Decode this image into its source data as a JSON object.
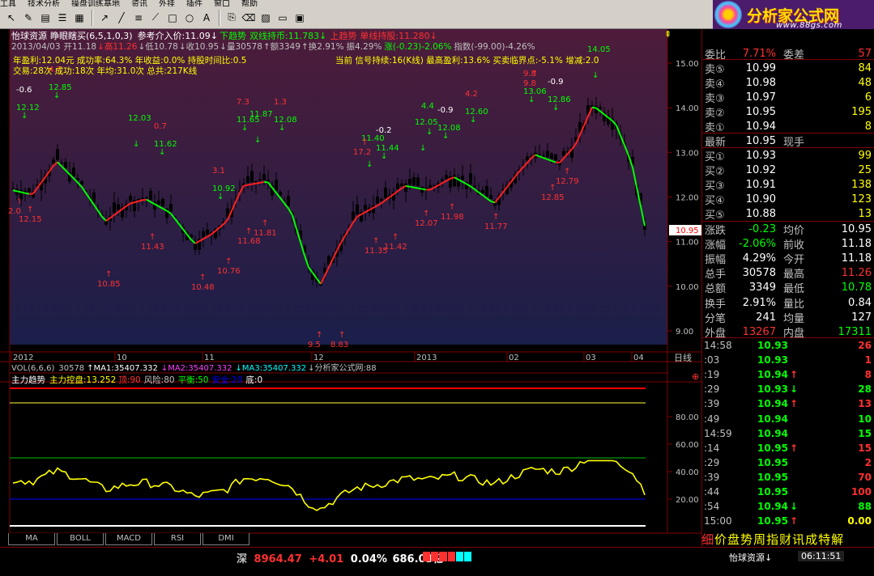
{
  "menu": [
    "工具",
    "技术分析",
    "操盘训练基地",
    "资讯",
    "外挂",
    "插件",
    "窗口",
    "帮助"
  ],
  "logo": {
    "title": "分析家公式网",
    "url": "www.88gs.com"
  },
  "toolbar_icons": [
    "pointer-icon",
    "tool-icon",
    "chart-icon",
    "list-icon",
    "grid-icon",
    "arrow-icon",
    "line-icon",
    "text-icon",
    "fork-icon",
    "rect-icon",
    "circle-icon",
    "a-icon",
    "copy-icon",
    "erase-icon",
    "palette-icon",
    "monitor-icon",
    "save-icon"
  ],
  "header": {
    "stock": "怡球资源",
    "indicator": "睁眼瞎买(6,5,1,0,3)",
    "line1": "参考介入价:11.09↓",
    "trend_down": "下趋势",
    "dual_hold": "双线持币:11.783↓",
    "trend_up": "上趋势",
    "single_hold": "单线持股:11.280↓",
    "date": "2013/04/03",
    "open": "开11.18",
    "high": "↓高11.26",
    "low": "↓低10.78",
    "close": "↓收10.95",
    "vol": "↓量30578",
    "amt": "↑额3349",
    "turnover": "↑换2.91%",
    "amp": "振4.29%",
    "chg": "涨(-0.23)-2.06%",
    "idx": "指数(-99.00)-4.26%"
  },
  "stats": {
    "line1": "年盈利:12.04元 成功率:64.3% 年收益:0.0% 持股时间比:0.5",
    "line2": "交易:28次 成功:18次 年均:31.0次 总共:217K线",
    "signal": "当前 信号持续:16(K线) 最高盈利:13.6% 买卖临界点:-5.1% 增减:2.0"
  },
  "price_axis": [
    "15.00",
    "14.00",
    "13.00",
    "12.00",
    "11.00",
    "10.00",
    "9.00"
  ],
  "current_price_tag": "10.95",
  "time_axis": [
    "2012",
    "10",
    "11",
    "12",
    "2013",
    "02",
    "03",
    "04"
  ],
  "period_label": "日线",
  "vol_line": {
    "label": "VOL(6,6,6)",
    "value": "30578",
    "ma1": "↑MA1:35407.332",
    "ma2": "↓MA2:35407.332",
    "ma3": "↓MA3:35407.332",
    "source": "↓分析家公式网:88"
  },
  "sub_line": {
    "label": "主力趋势",
    "ctrl": "主力控盘:13.252",
    "top": "顶:90",
    "risk": "风险:80",
    "balance": "平衡:50",
    "safe": "安全:20",
    "bottom": "底:0"
  },
  "sub_axis": [
    "80.00",
    "60.00",
    "40.00",
    "20.00"
  ],
  "chart_annotations": {
    "green": [
      [
        "-0.6",
        "12.12"
      ],
      [
        "4.7",
        "12.85"
      ],
      [
        "12.03"
      ],
      [
        "0.7",
        "11.62"
      ],
      [
        "3.1",
        "10.92"
      ],
      [
        "7.3",
        "11.65"
      ],
      [
        "11.87"
      ],
      [
        "1.3",
        "12.08"
      ],
      [
        "11.40"
      ],
      [
        "-0.2",
        "11.44"
      ],
      [
        "12.05"
      ],
      [
        "4.4"
      ],
      [
        "-0.9",
        "12.08"
      ],
      [
        "4.2",
        "12.60"
      ],
      [
        "9.8",
        "13.06"
      ],
      [
        "-0.9",
        "12.86"
      ],
      [
        "14.05"
      ]
    ],
    "red": [
      "2.0",
      "12.15",
      "10.85",
      "11.43",
      "10.48",
      "10.76",
      "11.68",
      "11.81",
      "9.5",
      "8.83",
      "17.2",
      "11.35",
      "11.42",
      "12.07",
      "11.98",
      "11.77",
      "12.85",
      "12.79",
      "9.8"
    ]
  },
  "quote": {
    "webi": {
      "label": "委比",
      "value": "7.71%",
      "label2": "委差",
      "value2": "57"
    },
    "sells": [
      {
        "label": "卖⑤",
        "price": "10.99",
        "vol": "84"
      },
      {
        "label": "卖④",
        "price": "10.98",
        "vol": "48"
      },
      {
        "label": "卖③",
        "price": "10.97",
        "vol": "6"
      },
      {
        "label": "卖②",
        "price": "10.95",
        "vol": "195"
      },
      {
        "label": "卖①",
        "price": "10.94",
        "vol": "8"
      }
    ],
    "latest": {
      "label": "最新",
      "price": "10.95",
      "label2": "现手"
    },
    "buys": [
      {
        "label": "买①",
        "price": "10.93",
        "vol": "99"
      },
      {
        "label": "买②",
        "price": "10.92",
        "vol": "25"
      },
      {
        "label": "买③",
        "price": "10.91",
        "vol": "138"
      },
      {
        "label": "买④",
        "price": "10.90",
        "vol": "123"
      },
      {
        "label": "买⑤",
        "price": "10.88",
        "vol": "13"
      }
    ],
    "stats": [
      {
        "l": "涨跌",
        "v": "-0.23",
        "l2": "均价",
        "v2": "10.95",
        "c": "#00ff00",
        "c2": "#ffffff"
      },
      {
        "l": "涨幅",
        "v": "-2.06%",
        "l2": "前收",
        "v2": "11.18",
        "c": "#00ff00",
        "c2": "#ffffff"
      },
      {
        "l": "振幅",
        "v": "4.29%",
        "l2": "今开",
        "v2": "11.18",
        "c": "#ffffff",
        "c2": "#ffffff"
      },
      {
        "l": "总手",
        "v": "30578",
        "l2": "最高",
        "v2": "11.26",
        "c": "#ffffff",
        "c2": "#ff3030"
      },
      {
        "l": "总额",
        "v": "3349",
        "l2": "最低",
        "v2": "10.78",
        "c": "#ffffff",
        "c2": "#00ff00"
      },
      {
        "l": "换手",
        "v": "2.91%",
        "l2": "量比",
        "v2": "0.84",
        "c": "#ffffff",
        "c2": "#ffffff"
      },
      {
        "l": "分笔",
        "v": "241",
        "l2": "均量",
        "v2": "127",
        "c": "#ffffff",
        "c2": "#ffffff"
      },
      {
        "l": "外盘",
        "v": "13267",
        "l2": "内盘",
        "v2": "17311",
        "c": "#ff3030",
        "c2": "#00ff00"
      }
    ]
  },
  "ticks": [
    {
      "t": "14:58",
      "p": "10.93",
      "a": "",
      "q": "26",
      "qc": "#ff3030"
    },
    {
      "t": ":03",
      "p": "10.93",
      "a": "",
      "q": "1",
      "qc": "#ff3030"
    },
    {
      "t": ":19",
      "p": "10.94",
      "a": "↑",
      "q": "8",
      "qc": "#ff3030"
    },
    {
      "t": ":29",
      "p": "10.93",
      "a": "↓",
      "q": "28",
      "qc": "#00ff00"
    },
    {
      "t": ":39",
      "p": "10.94",
      "a": "↑",
      "q": "13",
      "qc": "#ff3030"
    },
    {
      "t": ":49",
      "p": "10.94",
      "a": "",
      "q": "10",
      "qc": "#00ff00"
    },
    {
      "t": "14:59",
      "p": "10.94",
      "a": "",
      "q": "15",
      "qc": "#00ff00"
    },
    {
      "t": ":14",
      "p": "10.95",
      "a": "↑",
      "q": "15",
      "qc": "#ff3030"
    },
    {
      "t": ":29",
      "p": "10.95",
      "a": "",
      "q": "2",
      "qc": "#ff3030"
    },
    {
      "t": ":39",
      "p": "10.95",
      "a": "",
      "q": "70",
      "qc": "#ff3030"
    },
    {
      "t": ":44",
      "p": "10.95",
      "a": "",
      "q": "100",
      "qc": "#ff3030"
    },
    {
      "t": ":54",
      "p": "10.94",
      "a": "↓",
      "q": "88",
      "qc": "#00ff00"
    },
    {
      "t": "15:00",
      "p": "10.95",
      "a": "↑",
      "q": "0.00",
      "qc": "#ffff00"
    }
  ],
  "bottom_tabs": [
    "MA",
    "BOLL",
    "MACD",
    "RSI",
    "DMI"
  ],
  "func_tabs": [
    "细",
    "价",
    "盘",
    "势",
    "周",
    "指",
    "财",
    "讯",
    "成",
    "特",
    "解"
  ],
  "status": {
    "market": "深",
    "index": "8964.47",
    "chg": "+4.01",
    "pct": "0.04%",
    "amount": "686.03亿",
    "stock": "怡球资源↓",
    "clock": "06:11:51"
  },
  "colors": {
    "up": "#ff3030",
    "down": "#00ff00",
    "yellow": "#ffff00",
    "blue": "#0000ff",
    "bg_top": "#4e1c3a",
    "bg_bottom": "#1a1f4a"
  }
}
